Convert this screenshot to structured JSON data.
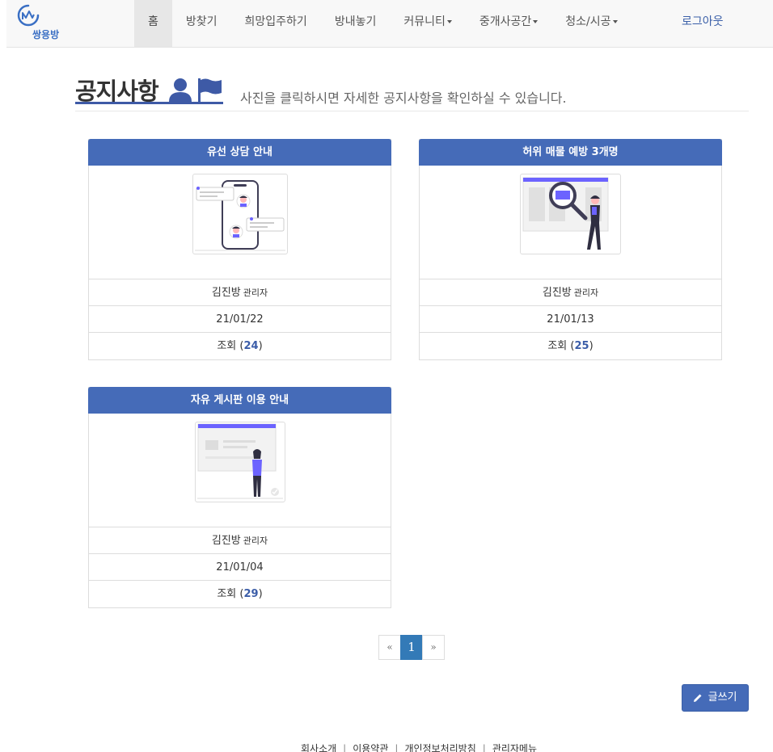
{
  "brand": {
    "name": "쌍용방"
  },
  "nav": {
    "items": [
      {
        "label": "홈",
        "active": true,
        "dropdown": false
      },
      {
        "label": "방찾기",
        "active": false,
        "dropdown": false
      },
      {
        "label": "희망입주하기",
        "active": false,
        "dropdown": false
      },
      {
        "label": "방내놓기",
        "active": false,
        "dropdown": false
      },
      {
        "label": "커뮤니티",
        "active": false,
        "dropdown": true
      },
      {
        "label": "중개사공간",
        "active": false,
        "dropdown": true
      },
      {
        "label": "청소/시공",
        "active": false,
        "dropdown": true
      }
    ],
    "logout": "로그아웃"
  },
  "page": {
    "title": "공지사항",
    "subtitle": "사진을 클릭하시면 자세한 공지사항을 확인하실 수 있습니다."
  },
  "notices": [
    {
      "title": "유선 상담 안내",
      "author": "김진방",
      "role": "관리자",
      "date": "21/01/22",
      "views_label": "조회",
      "views": "24",
      "image": "phone-chat-illustration"
    },
    {
      "title": "허위 매물 예방 3개명",
      "author": "김진방",
      "role": "관리자",
      "date": "21/01/13",
      "views_label": "조회",
      "views": "25",
      "image": "magnifier-search-illustration"
    },
    {
      "title": "자유 게시판 이용 안내",
      "author": "김진방",
      "role": "관리자",
      "date": "21/01/04",
      "views_label": "조회",
      "views": "29",
      "image": "person-board-illustration"
    }
  ],
  "pagination": {
    "prev": "«",
    "current": "1",
    "next": "»"
  },
  "write_button": "글쓰기",
  "footer": {
    "links": [
      "회사소개",
      "이용약관",
      "개인정보처리방침",
      "관리자메뉴"
    ]
  },
  "colors": {
    "primary": "#456bb8",
    "accent": "#337ab7",
    "title_underline": "#3e5aa6"
  }
}
